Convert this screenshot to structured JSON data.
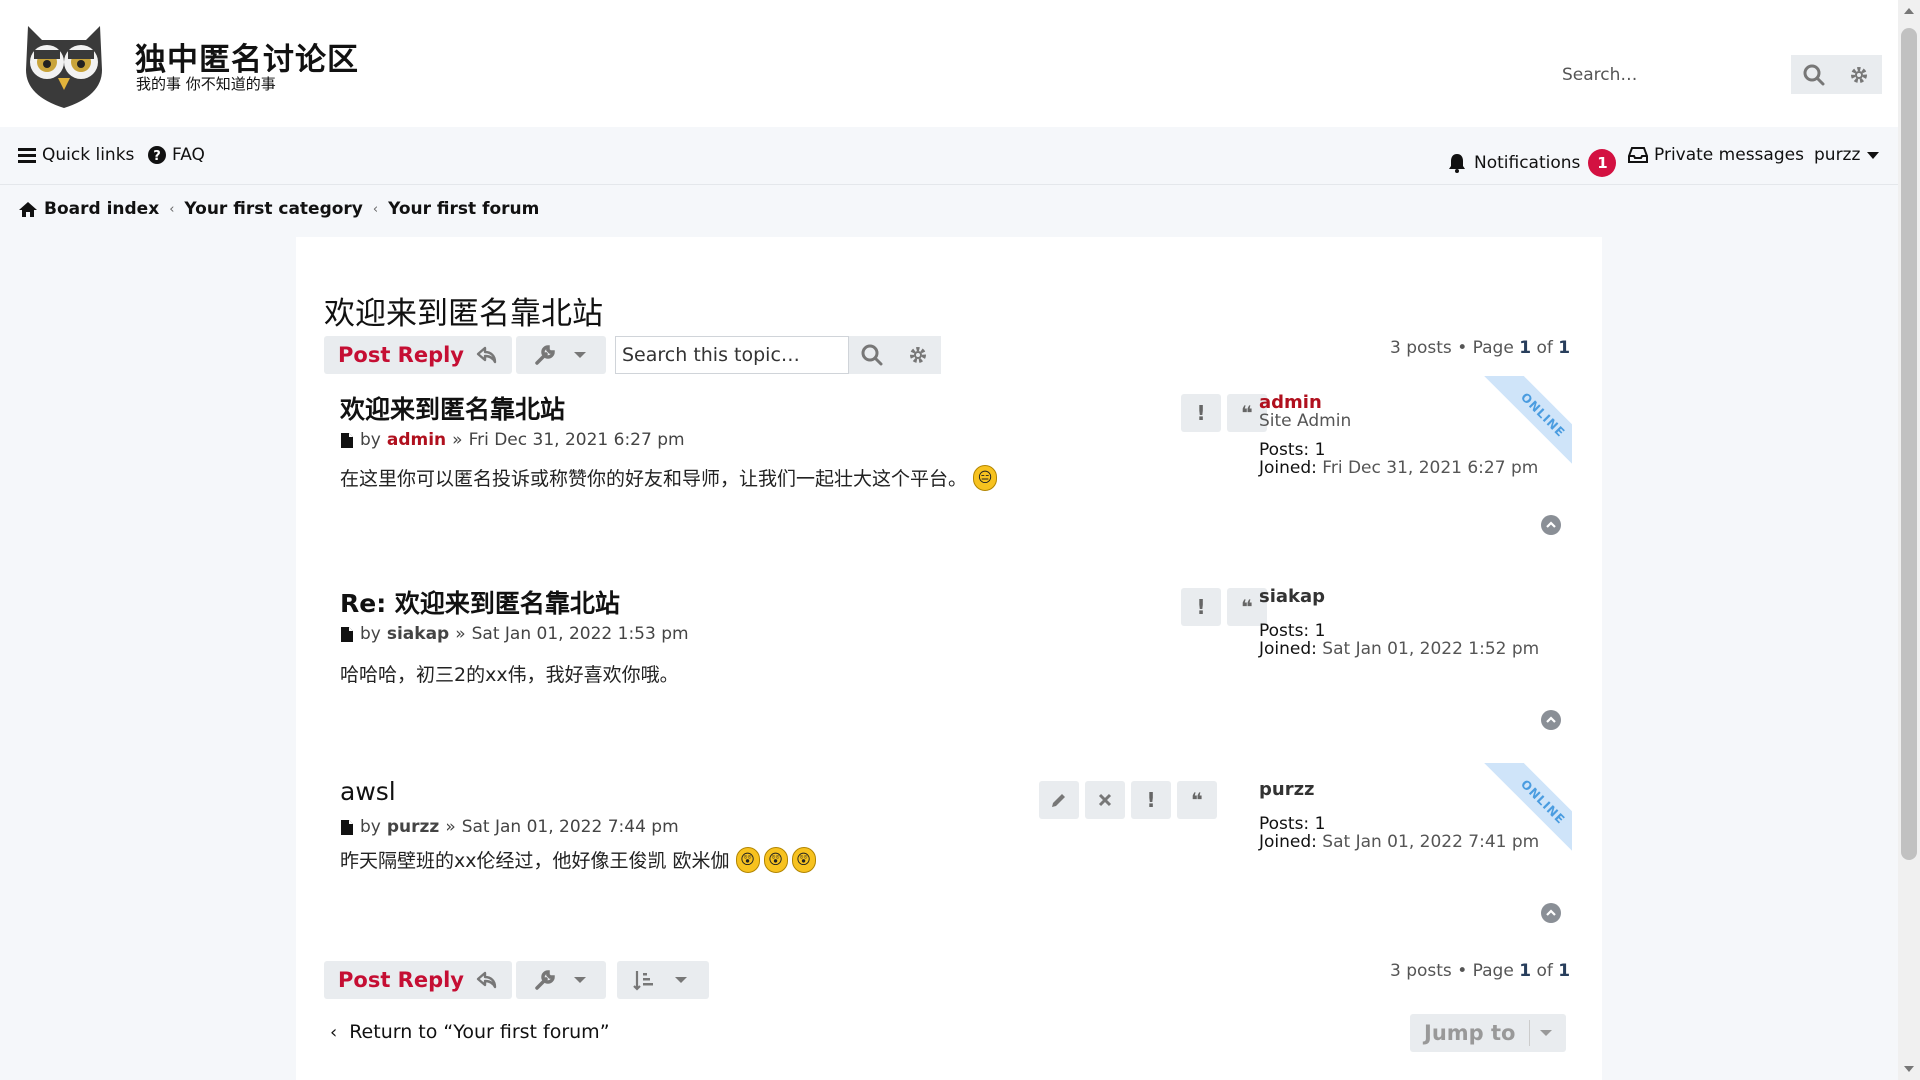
{
  "site": {
    "title": "独中匿名讨论区",
    "description": "我的事 你不知道的事",
    "search_placeholder": "Search…"
  },
  "nav": {
    "quick_links": "Quick links",
    "faq": "FAQ",
    "notifications": "Notifications",
    "notifications_count": "1",
    "private_messages": "Private messages",
    "username": "purzz"
  },
  "breadcrumb": {
    "board_index": "Board index",
    "category": "Your first category",
    "forum": "Your first forum"
  },
  "topic": {
    "title": "欢迎来到匿名靠北站",
    "post_reply": "Post Reply",
    "search_placeholder": "Search this topic…",
    "pagination_top": {
      "posts": "3 posts",
      "page_label": "Page",
      "page": "1",
      "of": "of",
      "total": "1"
    },
    "pagination_bottom": {
      "posts": "3 posts",
      "page_label": "Page",
      "page": "1",
      "of": "of",
      "total": "1"
    },
    "return_link": "Return to “Your first forum”",
    "jump_to": "Jump to"
  },
  "posts": [
    {
      "title": "欢迎来到匿名靠北站",
      "by": "by",
      "author": "admin",
      "date": "Fri Dec 31, 2021 6:27 pm",
      "body": "在这里你可以匿名投诉或称赞你的好友和导师，让我们一起壮大这个平台。",
      "emojis": [
        "😑"
      ],
      "profile": {
        "username": "admin",
        "rank": "Site Admin",
        "posts_label": "Posts:",
        "posts": "1",
        "joined_label": "Joined:",
        "joined": "Fri Dec 31, 2021 6:27 pm",
        "online": "ONLINE"
      }
    },
    {
      "title": "Re: 欢迎来到匿名靠北站",
      "by": "by",
      "author": "siakap",
      "date": "Sat Jan 01, 2022 1:53 pm",
      "body": "哈哈哈，初三2的xx伟，我好喜欢你哦。",
      "profile": {
        "username": "siakap",
        "posts_label": "Posts:",
        "posts": "1",
        "joined_label": "Joined:",
        "joined": "Sat Jan 01, 2022 1:52 pm"
      }
    },
    {
      "title": "awsl",
      "by": "by",
      "author": "purzz",
      "date": "Sat Jan 01, 2022 7:44 pm",
      "body": "昨天隔壁班的xx伦经过，他好像王俊凯 欧米伽",
      "emojis": [
        "😲",
        "😲",
        "😲"
      ],
      "profile": {
        "username": "purzz",
        "posts_label": "Posts:",
        "posts": "1",
        "joined_label": "Joined:",
        "joined": "Sat Jan 01, 2022 7:41 pm",
        "online": "ONLINE"
      }
    }
  ],
  "colors": {
    "accent_red": "#c50e33",
    "admin_red": "#aa0000",
    "badge_red": "#d31141",
    "page_bg": "#f5f7fa"
  },
  "icons": [
    "owl-logo-icon",
    "search-icon",
    "gear-icon",
    "bars-icon",
    "question-circle-icon",
    "bell-icon",
    "inbox-icon",
    "caret-down-icon",
    "home-icon",
    "chevron-left-icon",
    "reply-icon",
    "wrench-icon",
    "file-icon",
    "exclamation-icon",
    "quote-icon",
    "pencil-icon",
    "times-icon",
    "chevron-up-circle-icon",
    "sort-icon"
  ]
}
